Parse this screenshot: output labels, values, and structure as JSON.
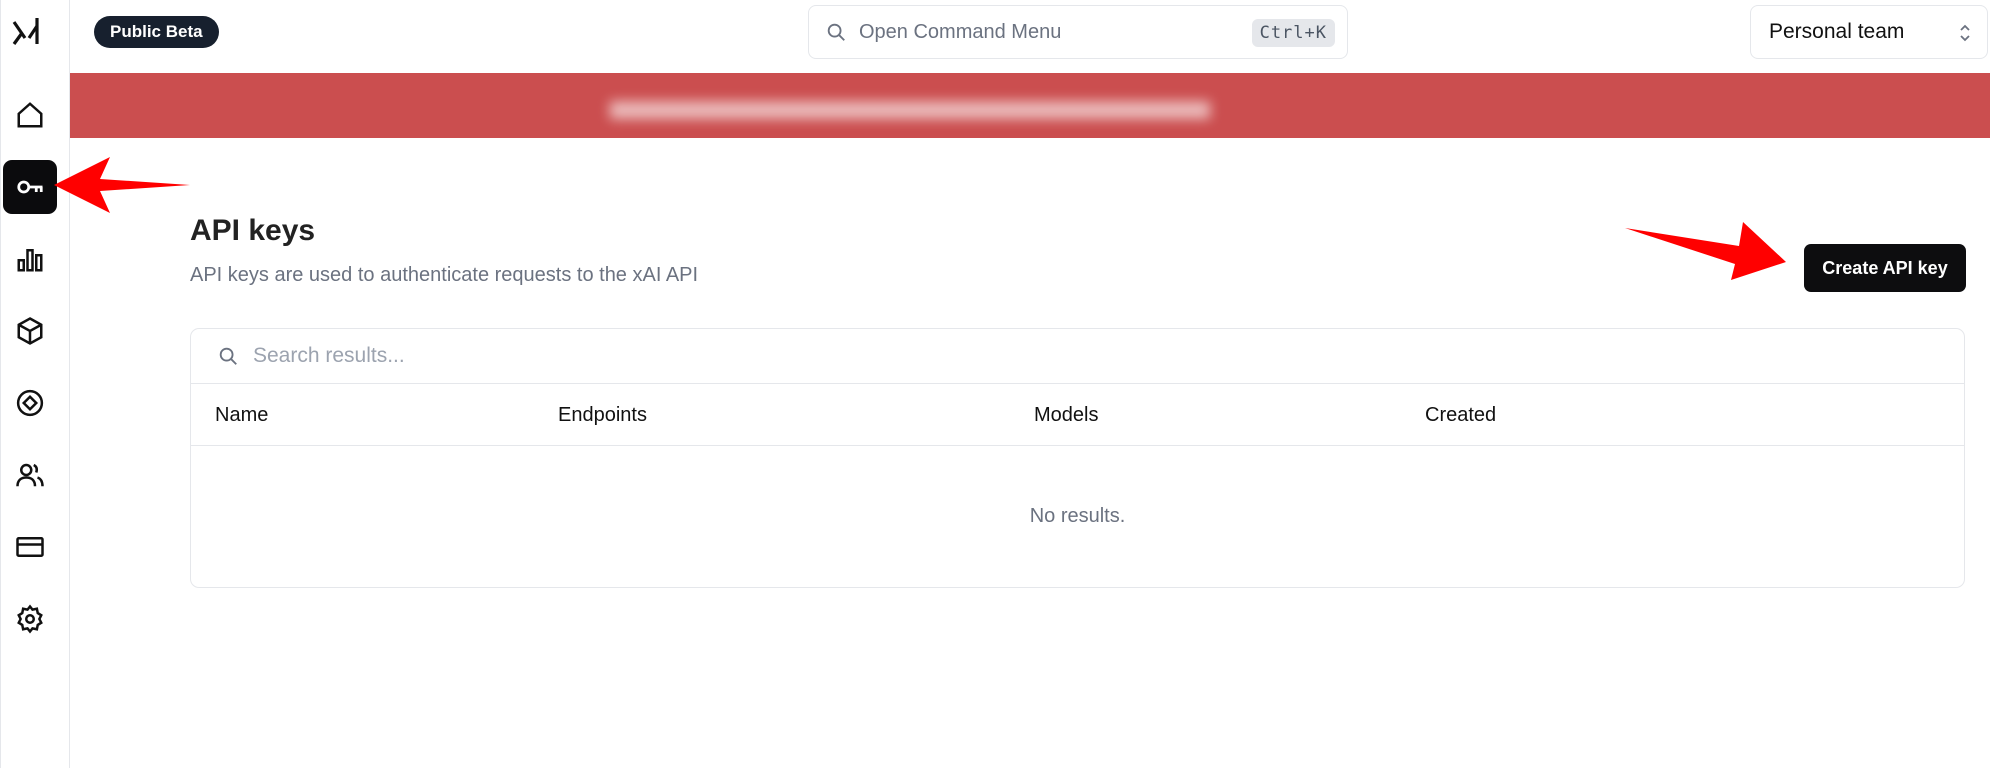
{
  "app": {
    "logo_name": "xAI"
  },
  "sidebar": {
    "items": [
      {
        "icon": "home-icon",
        "active": false
      },
      {
        "icon": "key-icon",
        "active": true
      },
      {
        "icon": "bar-chart-icon",
        "active": false
      },
      {
        "icon": "cube-icon",
        "active": false
      },
      {
        "icon": "compass-icon",
        "active": false
      },
      {
        "icon": "users-icon",
        "active": false
      },
      {
        "icon": "credit-card-icon",
        "active": false
      },
      {
        "icon": "gear-icon",
        "active": false
      }
    ]
  },
  "header": {
    "badge": "Public Beta",
    "command_menu": {
      "placeholder": "Open Command Menu",
      "shortcut": "Ctrl+K"
    },
    "team_selector": {
      "value": "Personal team"
    }
  },
  "banner": {
    "color": "#cb4e4f"
  },
  "main": {
    "title": "API keys",
    "description": "API keys are used to authenticate requests to the xAI API",
    "create_button": "Create API key",
    "table": {
      "search_placeholder": "Search results...",
      "columns": [
        "Name",
        "Endpoints",
        "Models",
        "Created"
      ],
      "empty_text": "No results."
    }
  },
  "annotations": {
    "arrow_color": "#ff0000"
  }
}
